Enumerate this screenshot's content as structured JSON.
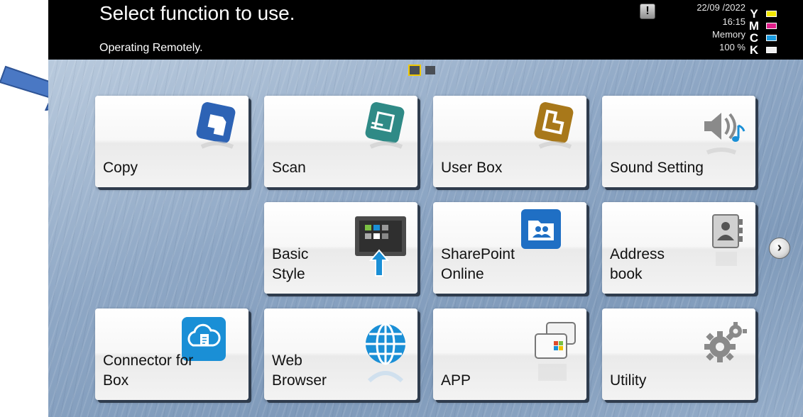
{
  "header": {
    "title": "Select function to use.",
    "status": "Operating Remotely.",
    "alert_symbol": "!",
    "date": "22/09 /2022",
    "time": "16:15",
    "memory_label": "Memory",
    "memory_value": "100 %",
    "toner": [
      {
        "letter": "Y",
        "color": "#f2e600"
      },
      {
        "letter": "M",
        "color": "#e0208a"
      },
      {
        "letter": "C",
        "color": "#1a9be0"
      },
      {
        "letter": "K",
        "color": "#222222"
      }
    ]
  },
  "page_indicator": {
    "current": 1,
    "total": 2
  },
  "tiles": [
    {
      "label": "Copy",
      "icon": "copy-icon"
    },
    {
      "label": "Scan",
      "icon": "scan-icon"
    },
    {
      "label": "User Box",
      "icon": "user-box-icon"
    },
    {
      "label": "Sound Setting",
      "icon": "speaker-icon"
    },
    {
      "label": "Basic Style",
      "icon": "basic-style-icon"
    },
    {
      "label": "SharePoint Online",
      "icon": "sharepoint-icon"
    },
    {
      "label": "Address book",
      "icon": "address-book-icon"
    },
    {
      "label": "Connector for Box",
      "icon": "cloud-connector-icon"
    },
    {
      "label": "Web Browser",
      "icon": "globe-icon"
    },
    {
      "label": "APP",
      "icon": "app-icon"
    },
    {
      "label": "Utility",
      "icon": "gear-icon"
    }
  ],
  "next_button": {
    "symbol": "›",
    "icon": "chevron-right-icon"
  },
  "colors": {
    "header_bg": "#000000",
    "pointer_arrow": "#4a78c4",
    "copy_icon": "#2d63b5",
    "scan_icon": "#2f8a86",
    "user_box_icon": "#a8781a",
    "sharepoint_icon": "#1f6fc4",
    "connector_icon": "#1a8fd6",
    "globe_icon": "#1a8fd6"
  }
}
